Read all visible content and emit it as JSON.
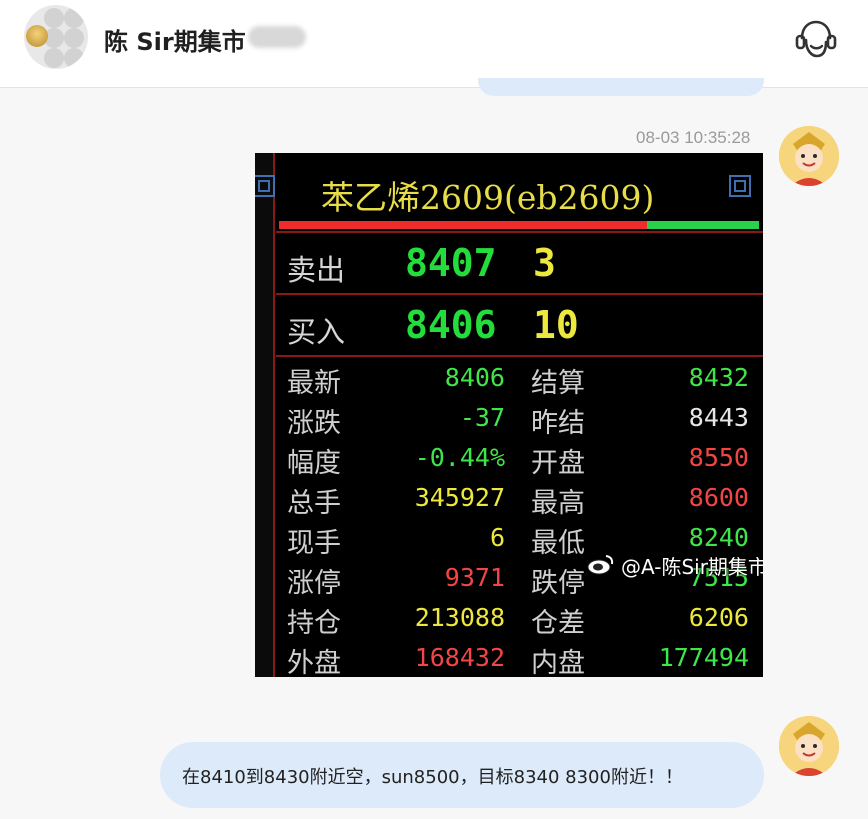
{
  "header": {
    "title": "陈 Sir期集市",
    "service_icon": "customer-service-icon"
  },
  "messages": [
    {
      "timestamp": "08-03 10:35:28",
      "image": {
        "title": "苯乙烯2609(eb2609)",
        "quote": {
          "sell_label": "卖出",
          "sell_price": "8407",
          "sell_volume": "3",
          "buy_label": "买入",
          "buy_price": "8406",
          "buy_volume": "10"
        },
        "rows": [
          {
            "l1": "最新",
            "v1": "8406",
            "c1": "#3ee64a",
            "l2": "结算",
            "v2": "8432",
            "c2": "#3ee64a"
          },
          {
            "l1": "涨跌",
            "v1": "-37",
            "c1": "#3ee64a",
            "l2": "昨结",
            "v2": "8443",
            "c2": "#e6e6e6"
          },
          {
            "l1": "幅度",
            "v1": "-0.44%",
            "c1": "#3ee64a",
            "l2": "开盘",
            "v2": "8550",
            "c2": "#f24545"
          },
          {
            "l1": "总手",
            "v1": "345927",
            "c1": "#ece83d",
            "l2": "最高",
            "v2": "8600",
            "c2": "#f24545"
          },
          {
            "l1": "现手",
            "v1": "6",
            "c1": "#ece83d",
            "l2": "最低",
            "v2": "8240",
            "c2": "#3ee64a"
          },
          {
            "l1": "涨停",
            "v1": "9371",
            "c1": "#f24545",
            "l2": "跌停",
            "v2": "7515",
            "c2": "#3ee64a"
          },
          {
            "l1": "持仓",
            "v1": "213088",
            "c1": "#ece83d",
            "l2": "仓差",
            "v2": "6206",
            "c2": "#ece83d"
          },
          {
            "l1": "外盘",
            "v1": "168432",
            "c1": "#f24545",
            "l2": "内盘",
            "v2": "177494",
            "c2": "#3ee64a"
          }
        ],
        "watermark": "@A-陈Sir期集市"
      }
    },
    {
      "text": "在8410到8430附近空，sun8500，目标8340 8300附近！！"
    }
  ],
  "colors": {
    "bubble": "#ddeafa",
    "price_up": "#f24545",
    "price_down": "#3ee64a",
    "volume": "#ece83d"
  }
}
